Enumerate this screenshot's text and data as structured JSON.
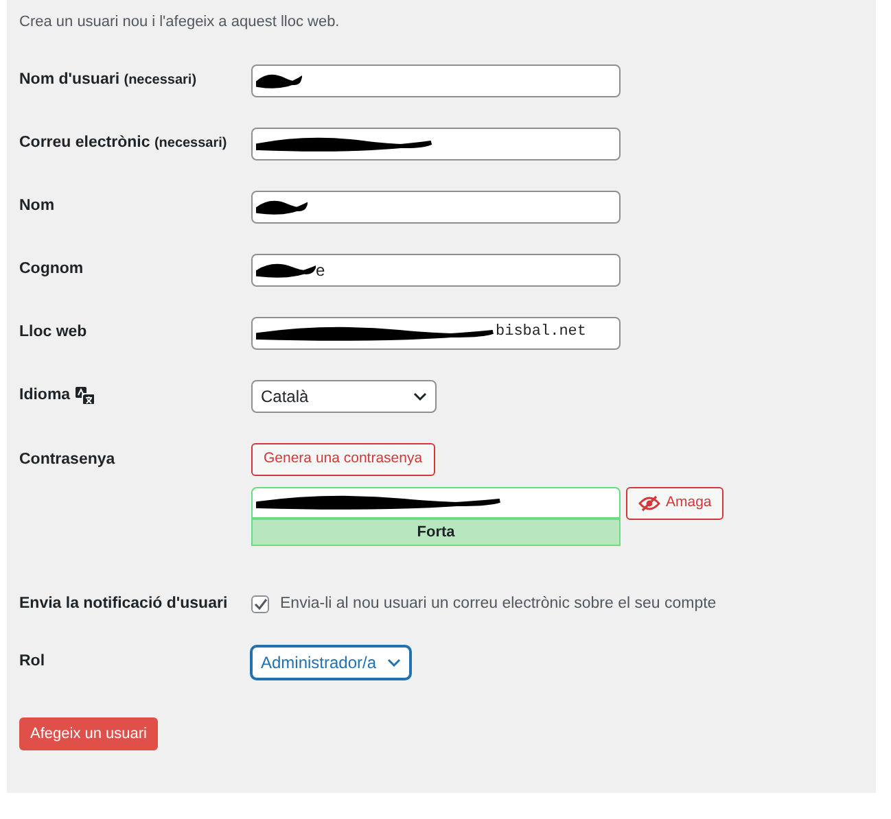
{
  "intro": "Crea un usuari nou i l'afegeix a aquest lloc web.",
  "fields": [
    {
      "kind": "text",
      "label": "Nom d'usuari",
      "note": "(necessari)",
      "redacted": true
    },
    {
      "kind": "text",
      "label": "Correu electrònic",
      "note": "(necessari)",
      "redacted": true
    },
    {
      "kind": "text",
      "label": "Nom",
      "redacted": true
    },
    {
      "kind": "text",
      "label": "Cognom",
      "value": "e",
      "redacted": true
    },
    {
      "kind": "url",
      "label": "Lloc web",
      "value": "bisbal.net",
      "redacted": true
    }
  ],
  "language": {
    "label": "Idioma",
    "value": "Català"
  },
  "password": {
    "label": "Contrasenya",
    "generate_button": "Genera una contrasenya",
    "redacted": true,
    "toggle_button": "Amaga",
    "strength": "Forta"
  },
  "notification": {
    "label": "Envia la notificació d'usuari",
    "checkbox_label": "Envia-li al nou usuari un correu electrònic sobre el seu compte",
    "checked": true
  },
  "role": {
    "label": "Rol",
    "value": "Administrador/a",
    "focused": true
  },
  "submit": "Afegeix un usuari"
}
